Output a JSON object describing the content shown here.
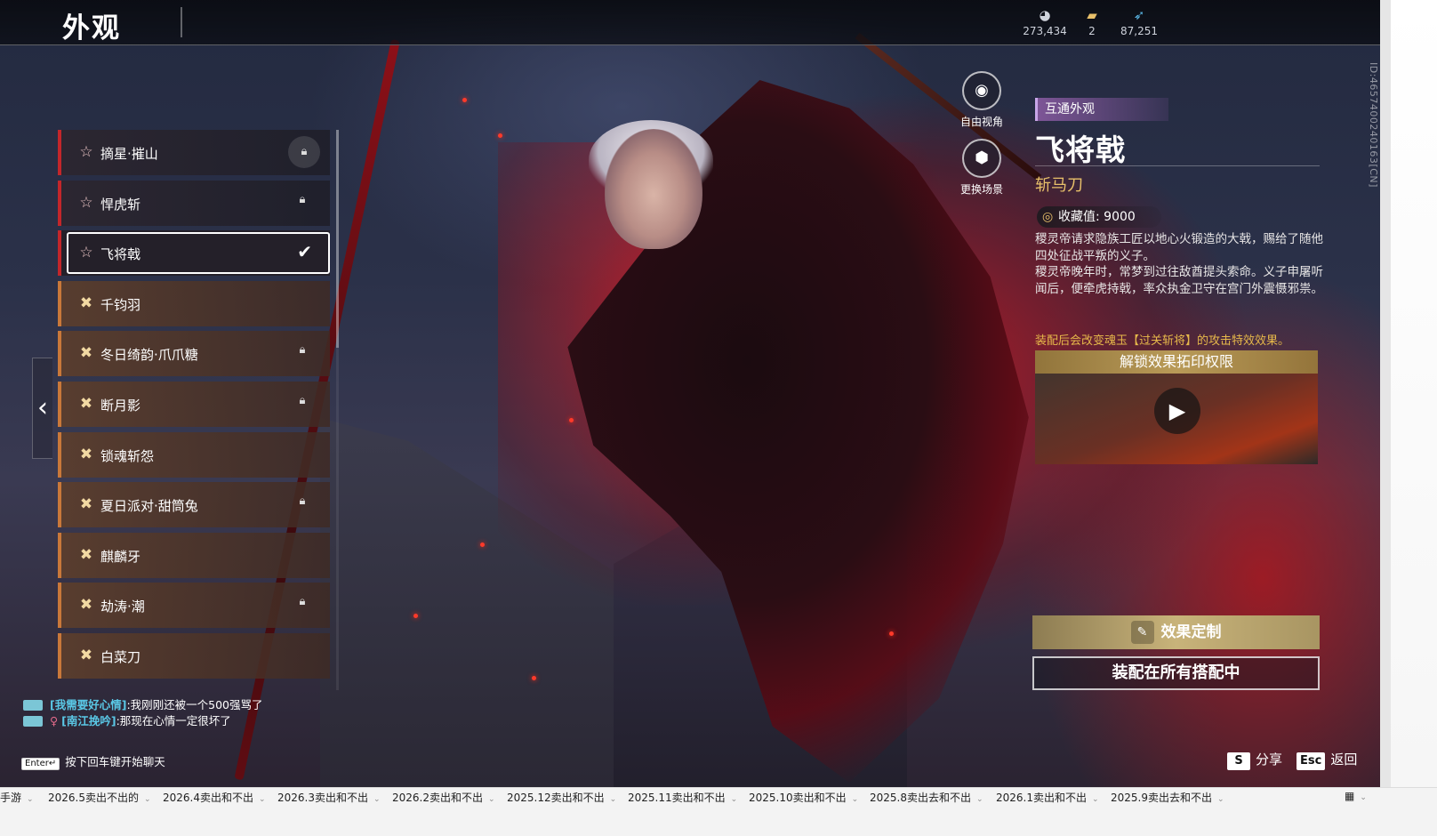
{
  "header": {
    "title": "外观",
    "currencies": [
      {
        "icon": "coin-icon",
        "value": "273,434"
      },
      {
        "icon": "ticket-icon",
        "value": "2"
      },
      {
        "icon": "feather-icon",
        "value": "87,251"
      }
    ]
  },
  "list": {
    "items": [
      {
        "label": "摘星·摧山",
        "mark": "☆",
        "status": "locked"
      },
      {
        "label": "悍虎斩",
        "mark": "☆",
        "status": "locked"
      },
      {
        "label": "飞将戟",
        "mark": "☆",
        "status": "selected"
      },
      {
        "label": "千钧羽",
        "mark": "✖",
        "status": "none"
      },
      {
        "label": "冬日绮韵·爪爪糖",
        "mark": "✖",
        "status": "locked"
      },
      {
        "label": "断月影",
        "mark": "✖",
        "status": "locked"
      },
      {
        "label": "锁魂斩怨",
        "mark": "✖",
        "status": "none"
      },
      {
        "label": "夏日派对·甜筒兔",
        "mark": "✖",
        "status": "locked"
      },
      {
        "label": "麒麟牙",
        "mark": "✖",
        "status": "none"
      },
      {
        "label": "劫涛·潮",
        "mark": "✖",
        "status": "locked"
      },
      {
        "label": "白菜刀",
        "mark": "✖",
        "status": "none"
      }
    ]
  },
  "view_buttons": {
    "free_view": "自由视角",
    "change_scene": "更换场景"
  },
  "detail": {
    "tag": "互通外观",
    "name": "飞将戟",
    "type": "斩马刀",
    "collect_value": "收藏值: 9000",
    "description": "稷灵帝请求隐族工匠以地心火锻造的大戟，赐给了随他四处征战平叛的义子。\n稷灵帝晚年时，常梦到过往敌酋提头索命。义子申屠听闻后，便牵虎持戟，率众执金卫守在宫门外震慑邪祟。",
    "effect_note": "装配后会改变魂玉【过关斩将】的攻击特效效果。",
    "unlock_title": "解锁效果拓印权限",
    "custom_button": "效果定制",
    "equip_button": "装配在所有搭配中",
    "id_text": "ID:4657400240163[CN]"
  },
  "chat": {
    "messages": [
      {
        "nick": "[我需要好心情]",
        "text": ":我刚刚还被一个500强骂了",
        "female": false
      },
      {
        "nick": "[南江挽吟]",
        "text": ":那现在心情一定很坏了",
        "female": true
      }
    ],
    "enter_key": "Enter↵",
    "hint": "按下回车键开始聊天"
  },
  "hotkeys": {
    "share_key": "S",
    "share_label": "分享",
    "back_key": "Esc",
    "back_label": "返回"
  },
  "taskbar": {
    "tabs": [
      "手游",
      "2026.5卖出不出的",
      "2026.4卖出和不出",
      "2026.3卖出和不出",
      "2026.2卖出和不出",
      "2025.12卖出和不出",
      "2025.11卖出和不出",
      "2025.10卖出和不出",
      "2025.8卖出去和不出",
      "2026.1卖出和不出",
      "2025.9卖出去和不出"
    ],
    "grid_icon": "grid-icon"
  },
  "colors": {
    "accent_gold": "#e8c06a",
    "orange_border": "#c9783a",
    "red_border": "#c3262a",
    "nick_blue": "#5ac8e6"
  }
}
